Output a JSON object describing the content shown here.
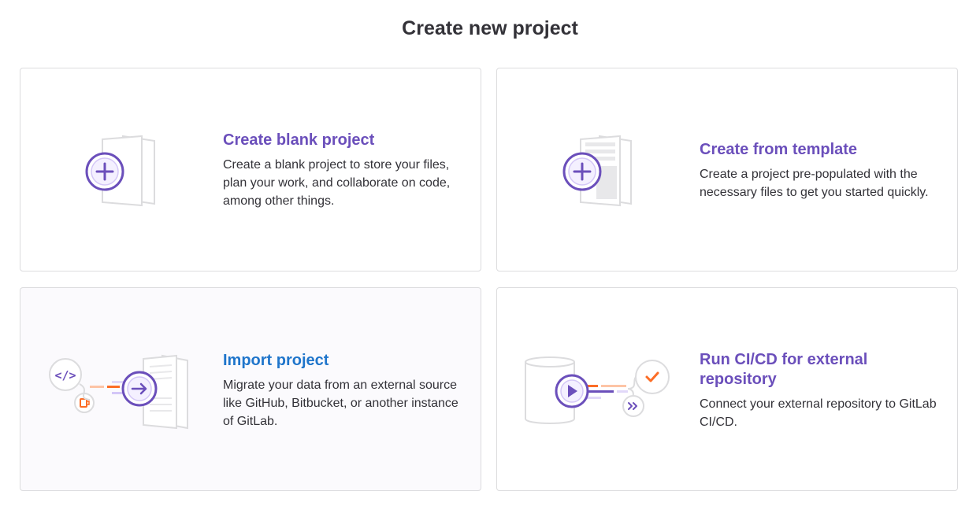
{
  "page": {
    "title": "Create new project"
  },
  "cards": [
    {
      "id": "blank",
      "title": "Create blank project",
      "description": "Create a blank project to store your files, plan your work, and collaborate on code, among other things.",
      "icon": "new-project-illustration"
    },
    {
      "id": "template",
      "title": "Create from template",
      "description": "Create a project pre-populated with the necessary files to get you started quickly.",
      "icon": "template-illustration"
    },
    {
      "id": "import",
      "title": "Import project",
      "description": "Migrate your data from an external source like GitHub, Bitbucket, or another instance of GitLab.",
      "icon": "import-illustration"
    },
    {
      "id": "cicd",
      "title": "Run CI/CD for external repository",
      "description": "Connect your external repository to GitLab CI/CD.",
      "icon": "cicd-illustration"
    }
  ],
  "colors": {
    "accent_purple": "#6b4fbb",
    "link_blue": "#1f75cb",
    "orange": "#fc6d26",
    "border": "#dcdcde"
  }
}
